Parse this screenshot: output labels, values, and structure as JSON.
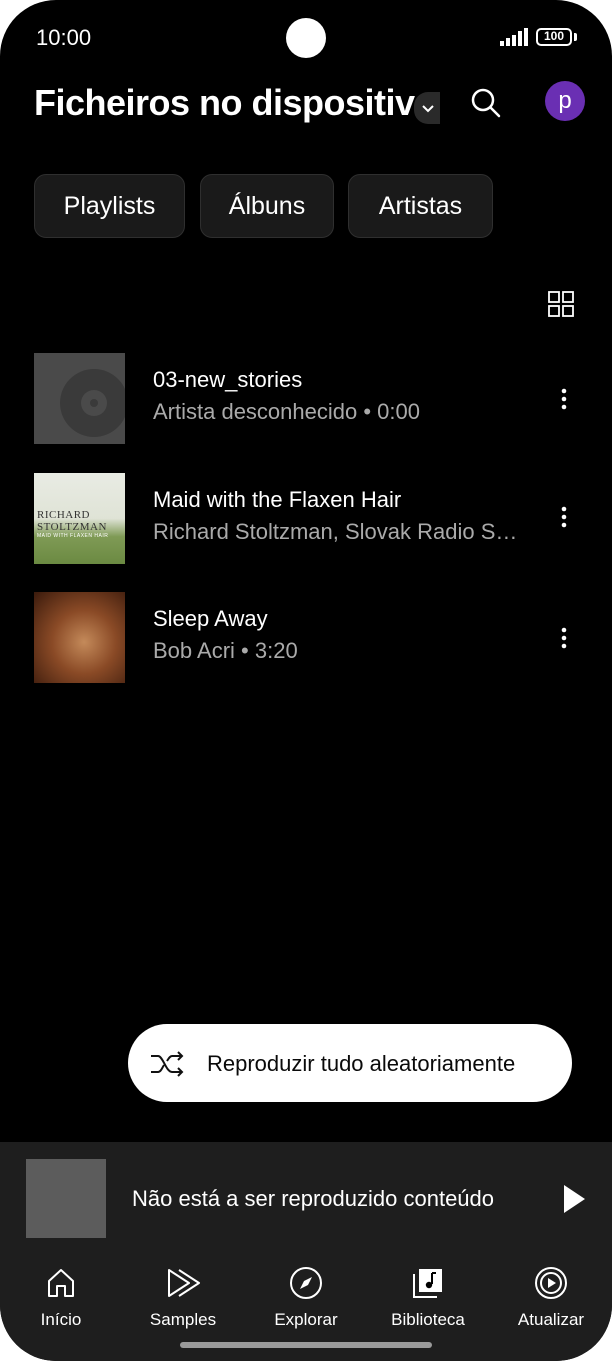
{
  "status_bar": {
    "time": "10:00",
    "battery": "100",
    "icons": [
      "signal-icon",
      "battery-icon"
    ]
  },
  "header": {
    "title": "Ficheiros no dispositivo",
    "avatar_letter": "p",
    "icons": [
      "chevron-down-icon",
      "search-icon"
    ]
  },
  "chips": [
    {
      "label": "Playlists"
    },
    {
      "label": "Álbuns"
    },
    {
      "label": "Artistas"
    }
  ],
  "tracks": [
    {
      "title": "03-new_stories",
      "subtitle": "Artista desconhecido • 0:00",
      "art_text": ""
    },
    {
      "title": "Maid with the Flaxen Hair",
      "subtitle": "Richard Stoltzman, Slovak Radio Symphony Orchestra",
      "art_text": "RICHARD STOLTZMAN",
      "art_subtext": "MAID WITH FLAXEN HAIR"
    },
    {
      "title": "Sleep Away",
      "subtitle": "Bob Acri • 3:20",
      "art_text": ""
    }
  ],
  "shuffle": {
    "label": "Reproduzir tudo aleatoriamente"
  },
  "mini_player": {
    "text": "Não está a ser reproduzido conteúdo"
  },
  "nav": [
    {
      "label": "Início",
      "icon": "home-icon"
    },
    {
      "label": "Samples",
      "icon": "samples-icon"
    },
    {
      "label": "Explorar",
      "icon": "compass-icon"
    },
    {
      "label": "Biblioteca",
      "icon": "library-icon"
    },
    {
      "label": "Atualizar",
      "icon": "upgrade-icon"
    }
  ],
  "colors": {
    "background": "#000000",
    "avatar": "#6a2fb3",
    "chip_bg": "#1a1a1a",
    "secondary_text": "#aaaaaa",
    "bar_bg": "#1e1e1e"
  }
}
